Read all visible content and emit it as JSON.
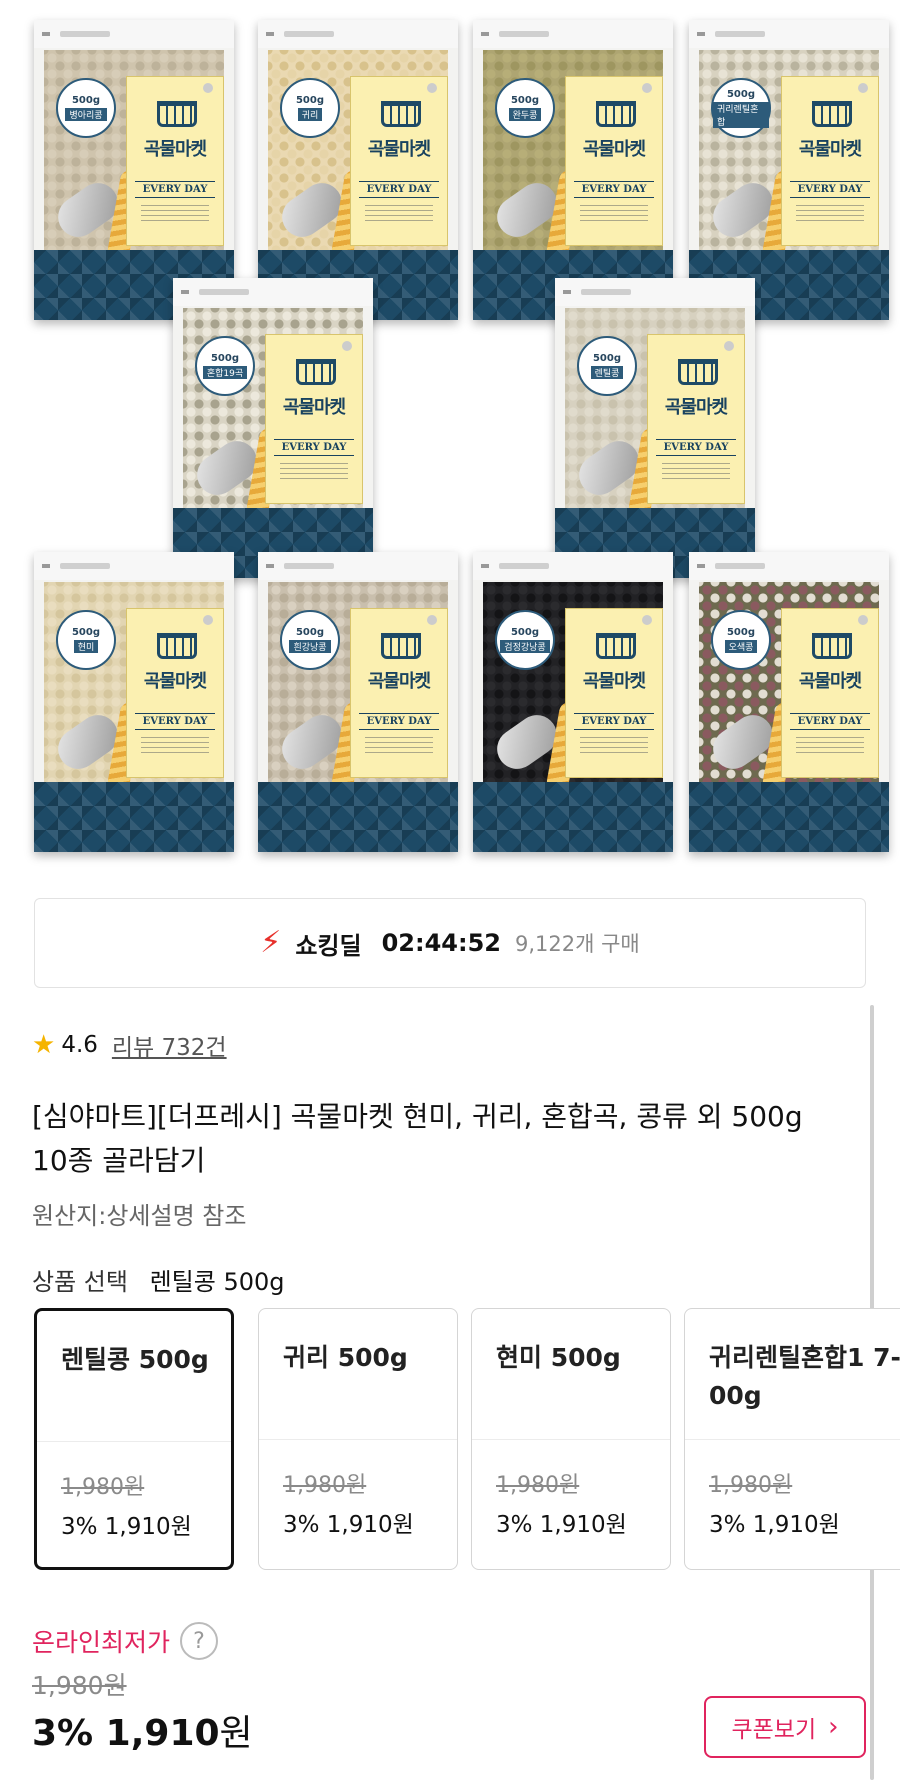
{
  "products_image": {
    "bags": [
      {
        "weight": "500g",
        "name": "병아리콩",
        "brand": "곡물마켓",
        "tagline": "EVERY DAY",
        "colors": {
          "g1": "#d7cdb8",
          "g2": "#bdb29a",
          "g3": "#cfc4ad"
        }
      },
      {
        "weight": "500g",
        "name": "귀리",
        "brand": "곡물마켓",
        "tagline": "EVERY DAY",
        "colors": {
          "g1": "#e6d4a8",
          "g2": "#d8c28c",
          "g3": "#ead9b2"
        }
      },
      {
        "weight": "500g",
        "name": "완두콩",
        "brand": "곡물마켓",
        "tagline": "EVERY DAY",
        "colors": {
          "g1": "#b7ae78",
          "g2": "#9e9660",
          "g3": "#aea572"
        }
      },
      {
        "weight": "500g",
        "name": "귀리렌틸혼합",
        "brand": "곡물마켓",
        "tagline": "EVERY DAY",
        "colors": {
          "g1": "#e8e3d5",
          "g2": "#b9b39e",
          "g3": "#d8d2c0"
        }
      },
      {
        "weight": "500g",
        "name": "혼합19곡",
        "brand": "곡물마켓",
        "tagline": "EVERY DAY",
        "colors": {
          "g1": "#ece8dc",
          "g2": "#a8a38e",
          "g3": "#d9d4c4"
        }
      },
      {
        "weight": "500g",
        "name": "렌틸콩",
        "brand": "곡물마켓",
        "tagline": "EVERY DAY",
        "colors": {
          "g1": "#e0dbcc",
          "g2": "#c9c2ad",
          "g3": "#d7d1c0"
        }
      },
      {
        "weight": "500g",
        "name": "현미",
        "brand": "곡물마켓",
        "tagline": "EVERY DAY",
        "colors": {
          "g1": "#e9ddbf",
          "g2": "#d5c69d",
          "g3": "#e2d5b2"
        }
      },
      {
        "weight": "500g",
        "name": "흰강낭콩",
        "brand": "곡물마켓",
        "tagline": "EVERY DAY",
        "colors": {
          "g1": "#d9d0c0",
          "g2": "#b8ad98",
          "g3": "#c9bfad"
        }
      },
      {
        "weight": "500g",
        "name": "검정강낭콩",
        "brand": "곡물마켓",
        "tagline": "EVERY DAY",
        "colors": {
          "g1": "#2b2b2e",
          "g2": "#141416",
          "g3": "#222225"
        }
      },
      {
        "weight": "500g",
        "name": "오색콩",
        "brand": "곡물마켓",
        "tagline": "EVERY DAY",
        "colors": {
          "g1": "#8a5a5f",
          "g2": "#e2ddd2",
          "g3": "#6e6a4f"
        }
      }
    ]
  },
  "deal": {
    "icon": "lightning-icon",
    "name": "쇼킹딜",
    "timer": "02:44:52",
    "sold": "9,122개 구매"
  },
  "rating": {
    "score": "4.6",
    "reviews": "리뷰 732건"
  },
  "product": {
    "title": "[심야마트][더프레시] 곡물마켓 현미, 귀리, 혼합곡, 콩류 외 500g 10종 골라담기",
    "origin": "원산지:상세설명 참조"
  },
  "option_select": {
    "label": "상품 선택",
    "selected": "렌틸콩 500g",
    "options": [
      {
        "name": "렌틸콩 500g",
        "original": "1,980원",
        "sale": "3% 1,910원"
      },
      {
        "name": "귀리 500g",
        "original": "1,980원",
        "sale": "3% 1,910원"
      },
      {
        "name": "현미 500g",
        "original": "1,980원",
        "sale": "3% 1,910원"
      },
      {
        "name": "귀리렌틸혼합1 7­00g",
        "original": "1,980원",
        "sale": "3% 1,910원"
      }
    ]
  },
  "price": {
    "lowest_label": "온라인최저가",
    "help": "?",
    "original": "1,980원",
    "discount": "3%",
    "final": "1,910",
    "unit": "원",
    "coupon": "쿠폰보기",
    "coupon_chevron": "›"
  },
  "colors": {
    "accent": "#e0245e",
    "deal_red": "#e7302b",
    "star": "#f5b400",
    "bag_navy": "#1d4a66"
  }
}
